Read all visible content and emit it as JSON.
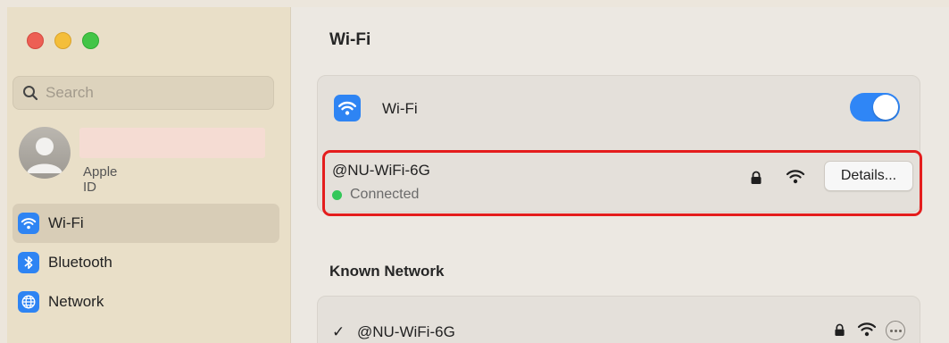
{
  "sidebar": {
    "search_placeholder": "Search",
    "profile": {
      "subtitle": "Apple ID"
    },
    "items": [
      {
        "label": "Wi-Fi",
        "icon": "wifi-icon",
        "active": true
      },
      {
        "label": "Bluetooth",
        "icon": "bluetooth-icon",
        "active": false
      },
      {
        "label": "Network",
        "icon": "globe-icon",
        "active": false
      }
    ]
  },
  "main": {
    "title": "Wi-Fi",
    "wifi_toggle": {
      "label": "Wi-Fi",
      "state": "on"
    },
    "current_network": {
      "name": "@NU-WiFi-6G",
      "status": "Connected",
      "details_label": "Details..."
    },
    "known_section_title": "Known Network",
    "known_networks": [
      {
        "check": "✓",
        "name": "@NU-WiFi-6G"
      }
    ]
  },
  "colors": {
    "accent": "#2e84f3",
    "highlight": "#e41d1d",
    "connected": "#34c759",
    "sidebar_bg": "#e9dfc8"
  }
}
